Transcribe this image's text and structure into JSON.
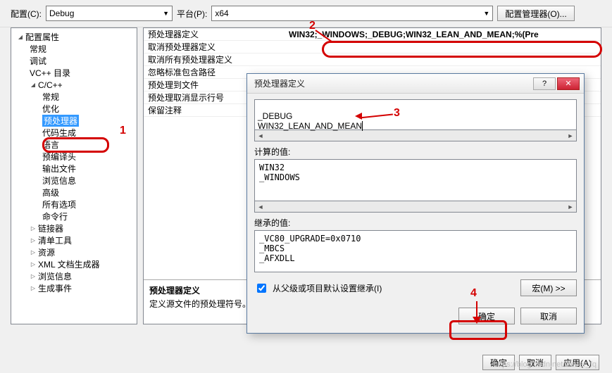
{
  "topbar": {
    "config_label": "配置(C):",
    "config_value": "Debug",
    "platform_label": "平台(P):",
    "platform_value": "x64",
    "manager_btn": "配置管理器(O)..."
  },
  "tree": {
    "root": "配置属性",
    "general": "常规",
    "debugging": "调试",
    "vcdirs": "VC++ 目录",
    "cc": "C/C++",
    "cc_general": "常规",
    "cc_optimization": "优化",
    "cc_preprocessor": "预处理器",
    "cc_codegen": "代码生成",
    "cc_language": "语言",
    "cc_pch": "预编译头",
    "cc_output": "输出文件",
    "cc_browse": "浏览信息",
    "cc_advanced": "高级",
    "cc_all": "所有选项",
    "cc_cmdline": "命令行",
    "linker": "链接器",
    "manifest": "清单工具",
    "resources": "资源",
    "xmldoc": "XML 文档生成器",
    "browseinfo": "浏览信息",
    "buildevents": "生成事件"
  },
  "props": {
    "row0_label": "预处理器定义",
    "row0_value": "WIN32;_WINDOWS;_DEBUG;WIN32_LEAN_AND_MEAN;%(Pre",
    "row1_label": "取消预处理器定义",
    "row2_label": "取消所有预处理器定义",
    "row3_label": "忽略标准包含路径",
    "row4_label": "预处理到文件",
    "row5_label": "预处理取消显示行号",
    "row6_label": "保留注释",
    "desc_title": "预处理器定义",
    "desc_body": "定义源文件的预处理符号。"
  },
  "dialog": {
    "title": "预处理器定义",
    "textarea_line1": "_DEBUG",
    "textarea_line2": "WIN32_LEAN_AND_MEAN",
    "calc_label": "计算的值:",
    "calc_text": "WIN32\n_WINDOWS",
    "inherit_label": "继承的值:",
    "inherit_text": "_VC80_UPGRADE=0x0710\n_MBCS\n_AFXDLL",
    "inherit_chk": "从父级或项目默认设置继承(I)",
    "macro_btn": "宏(M) >>",
    "ok": "确定",
    "cancel": "取消"
  },
  "bottom": {
    "ok": "确定",
    "cancel": "取消",
    "apply": "应用(A)"
  },
  "watermark": "https://blog.csdn.net/clever_fq",
  "annotations": {
    "a1": "1",
    "a2": "2",
    "a3": "3",
    "a4": "4"
  }
}
